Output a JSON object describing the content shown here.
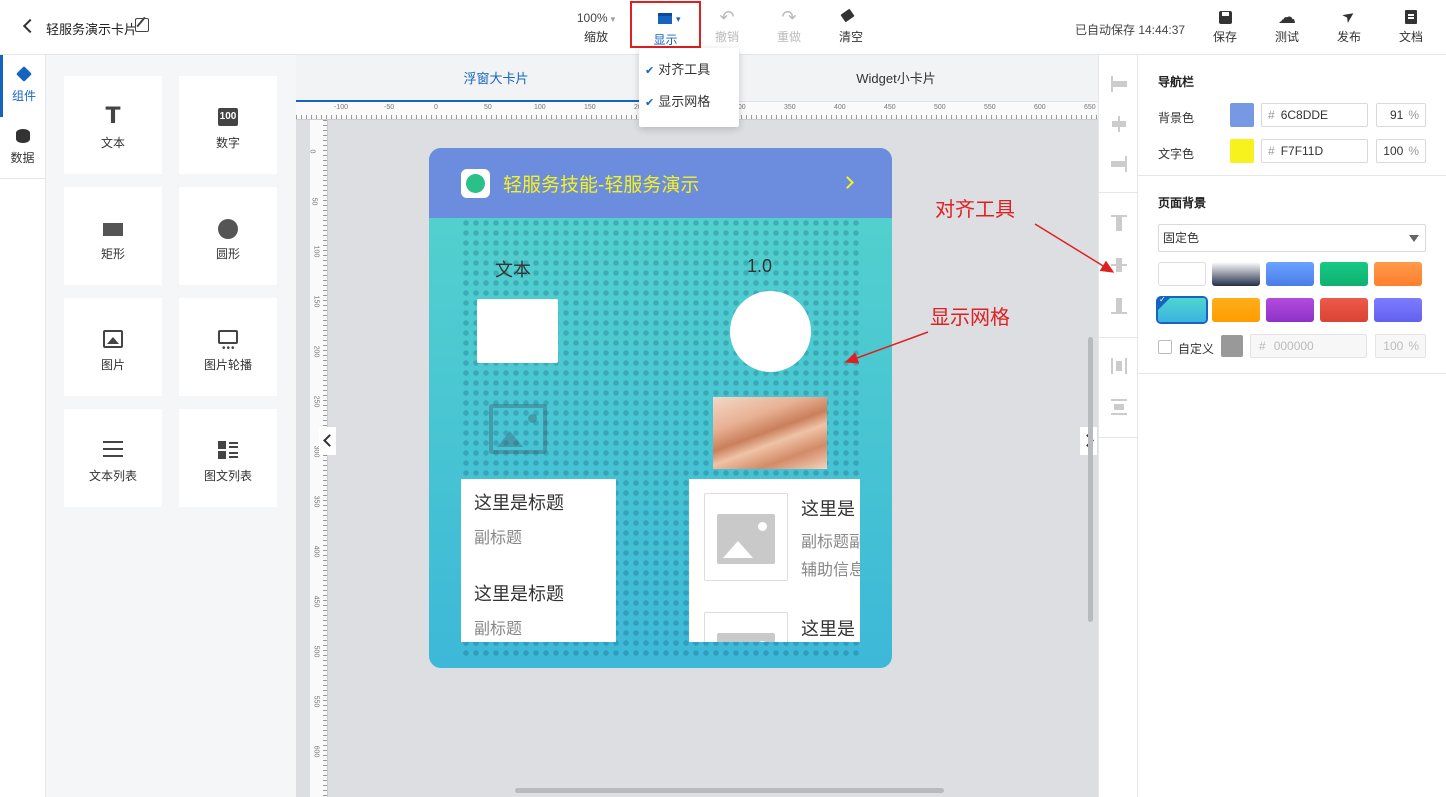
{
  "header": {
    "title": "轻服务演示卡片",
    "zoom_value": "100%",
    "zoom_label": "缩放",
    "show_label": "显示",
    "undo_label": "撤销",
    "redo_label": "重做",
    "clear_label": "清空",
    "autosave": "已自动保存 14:44:37",
    "save_label": "保存",
    "test_label": "测试",
    "publish_label": "发布",
    "docs_label": "文档"
  },
  "show_menu": {
    "items": [
      "对齐工具",
      "显示网格"
    ]
  },
  "left_tabs": [
    "组件",
    "数据"
  ],
  "components": [
    "文本",
    "数字",
    "矩形",
    "圆形",
    "图片",
    "图片轮播",
    "文本列表",
    "图文列表"
  ],
  "canvas": {
    "tabs": [
      "浮窗大卡片",
      "Widget小卡片"
    ],
    "ruler_h": [
      "-100",
      "-50",
      "0",
      "50",
      "100",
      "150",
      "200",
      "250",
      "300",
      "350",
      "400",
      "450",
      "500",
      "550",
      "600",
      "650"
    ],
    "ruler_v": [
      "0",
      "50",
      "100",
      "150",
      "200",
      "250",
      "300",
      "350",
      "400",
      "450",
      "500",
      "550",
      "600"
    ]
  },
  "card": {
    "title": "轻服务技能-轻服务演示",
    "text_widget": "文本",
    "number_widget": "1.0",
    "text_list": [
      {
        "title": "这里是标题",
        "subtitle": "副标题"
      },
      {
        "title": "这里是标题",
        "subtitle": "副标题"
      }
    ],
    "image_list": [
      {
        "title": "这里是",
        "subtitle": "副标题副",
        "aux": "辅助信息"
      },
      {
        "title": "这里是"
      }
    ]
  },
  "annotations": {
    "align": "对齐工具",
    "grid": "显示网格"
  },
  "props": {
    "navbar_title": "导航栏",
    "bg_label": "背景色",
    "bg_hex": "6C8DDE",
    "bg_pct": "91",
    "text_label": "文字色",
    "text_hex": "F7F11D",
    "text_pct": "100",
    "hash": "#",
    "pct_sign": "%",
    "page_bg_title": "页面背景",
    "page_bg_mode": "固定色",
    "custom_label": "自定义",
    "custom_hex": "000000",
    "custom_pct": "100"
  },
  "colors": {
    "accent": "#1565c0",
    "nav_bg": "#6c8dde",
    "nav_text": "#f7f11d",
    "annotation": "#e02020",
    "bg_swatches": [
      [
        "#ffffff",
        "#1f2a44"
      ],
      [
        "#ffffff",
        "#243049"
      ],
      [
        "#6aa2ff",
        "#4a7de8"
      ],
      [
        "#18c985",
        "#0fb070"
      ],
      [
        "#ff9a4a",
        "#ff7f2e"
      ],
      [
        "#4fd6cf",
        "#3bb3e0"
      ],
      [
        "#ffae1a",
        "#ff9c00"
      ],
      [
        "#b44be0",
        "#8e32c8"
      ],
      [
        "#ee5a4a",
        "#d94434"
      ],
      [
        "#7c7cff",
        "#6161f0"
      ]
    ]
  }
}
